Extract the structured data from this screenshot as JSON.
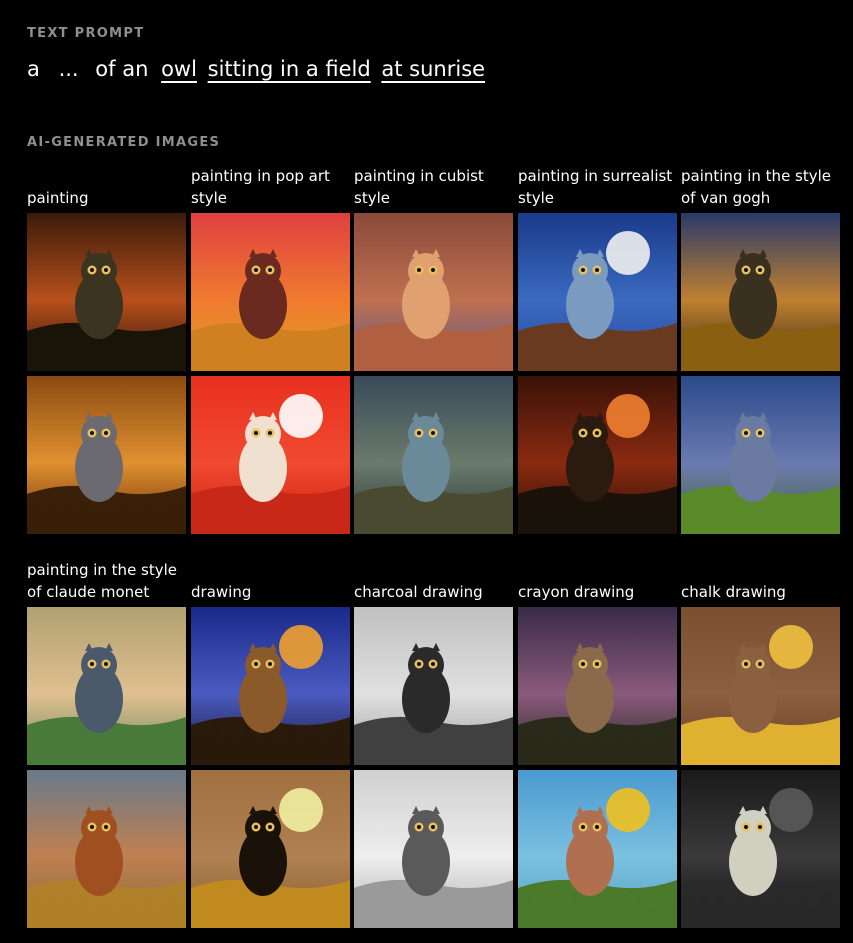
{
  "text_prompt": {
    "label": "TEXT PROMPT",
    "prefix": "a",
    "ellipsis": "...",
    "connector": "of an",
    "tokens": [
      "owl",
      "sitting in a field",
      "at sunrise"
    ]
  },
  "gallery": {
    "label": "AI-GENERATED IMAGES",
    "groups": [
      {
        "styles": [
          {
            "caption": "painting"
          },
          {
            "caption": "painting in pop art style"
          },
          {
            "caption": "painting in cubist style"
          },
          {
            "caption": "painting in surrealist style"
          },
          {
            "caption": "painting in the style of van gogh"
          }
        ]
      },
      {
        "styles": [
          {
            "caption": "painting in the style of claude monet"
          },
          {
            "caption": "drawing"
          },
          {
            "caption": "charcoal drawing"
          },
          {
            "caption": "crayon drawing"
          },
          {
            "caption": "chalk drawing"
          }
        ]
      }
    ]
  },
  "colors": {
    "background": "#000000",
    "section_label": "#8f8f8f",
    "text": "#ffffff"
  }
}
